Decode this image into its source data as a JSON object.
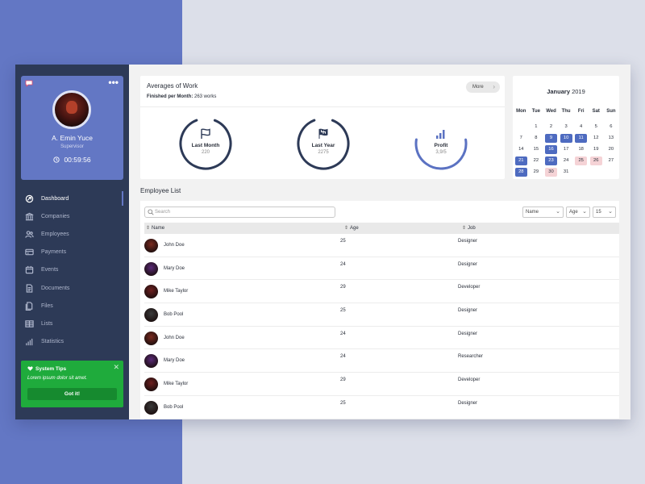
{
  "profile": {
    "name": "A. Emin Yuce",
    "role": "Supervisor",
    "timer": "00:59:56",
    "menu_label": "•••"
  },
  "nav": {
    "items": [
      {
        "label": "Dashboard",
        "icon": "dashboard-icon"
      },
      {
        "label": "Companies",
        "icon": "bank-icon"
      },
      {
        "label": "Employees",
        "icon": "users-icon"
      },
      {
        "label": "Payments",
        "icon": "card-icon"
      },
      {
        "label": "Events",
        "icon": "calendar-icon"
      },
      {
        "label": "Documents",
        "icon": "document-icon"
      },
      {
        "label": "Files",
        "icon": "files-icon"
      },
      {
        "label": "Lists",
        "icon": "table-icon"
      },
      {
        "label": "Statistics",
        "icon": "bar-chart-icon"
      }
    ],
    "active": "Dashboard"
  },
  "tips": {
    "title": "System Tips",
    "body": "Lorem ipsum dolor sit amet.",
    "button": "Got it!",
    "close": "✕"
  },
  "averages": {
    "title": "Averages of Work",
    "sub_label": "Finished per Month:",
    "sub_value": "263 works",
    "more": "More",
    "gauges": [
      {
        "label": "Last Month",
        "value": "220",
        "fraction": 0.88,
        "color": "#2d3a57",
        "icon": "flag-outline-icon"
      },
      {
        "label": "Last Year",
        "value": "2275",
        "fraction": 0.88,
        "color": "#2d3a57",
        "icon": "flag-checkered-icon"
      },
      {
        "label": "Profit",
        "value": "3,9/5",
        "fraction": 0.55,
        "color": "#5b72c2",
        "icon": "signal-bars-icon"
      }
    ]
  },
  "calendar": {
    "month": "January",
    "year": "2019",
    "weekdays": [
      "Mon",
      "Tue",
      "Wed",
      "Thu",
      "Fri",
      "Sat",
      "Sun"
    ],
    "days": [
      {
        "d": "",
        "s": ""
      },
      {
        "d": "",
        "s": ""
      },
      {
        "d": "",
        "s": ""
      },
      {
        "d": "",
        "s": ""
      },
      {
        "d": "",
        "s": ""
      },
      {
        "d": "",
        "s": ""
      },
      {
        "d": "",
        "s": ""
      }
    ],
    "grid": [
      [
        "",
        "1",
        "2",
        "3",
        "4",
        "5",
        "6"
      ],
      [
        "7",
        "8",
        "9",
        "10",
        "11",
        "12",
        "13"
      ],
      [
        "14",
        "15",
        "16",
        "17",
        "18",
        "19",
        "20"
      ],
      [
        "21",
        "22",
        "23",
        "24",
        "25",
        "26",
        "27"
      ],
      [
        "28",
        "29",
        "30",
        "31",
        "",
        "",
        ""
      ]
    ],
    "highlighted_blue": [
      "9",
      "10",
      "11",
      "16",
      "21",
      "23",
      "28"
    ],
    "highlighted_pink": [
      "25",
      "26",
      "30"
    ],
    "colors": {
      "blue": "#4e6bc0",
      "pink": "#f5d3d6"
    }
  },
  "employees": {
    "title": "Employee List",
    "search_placeholder": "Search",
    "sort_select": "Name",
    "field_select": "Age",
    "page_size": "15",
    "columns": [
      "Name",
      "Age",
      "Job"
    ],
    "rows": [
      {
        "name": "John Doe",
        "age": "25",
        "job": "Designer",
        "avatar": "#7a2a1f"
      },
      {
        "name": "Mary Doe",
        "age": "24",
        "job": "Designer",
        "avatar": "#5a2a78"
      },
      {
        "name": "Mike Taylor",
        "age": "29",
        "job": "Developer",
        "avatar": "#6e2020"
      },
      {
        "name": "Bob Pool",
        "age": "25",
        "job": "Designer",
        "avatar": "#3a3a3a"
      },
      {
        "name": "John Doe",
        "age": "24",
        "job": "Designer",
        "avatar": "#7a2a1f"
      },
      {
        "name": "Mary Doe",
        "age": "24",
        "job": "Researcher",
        "avatar": "#5a2a78"
      },
      {
        "name": "Mike Taylor",
        "age": "29",
        "job": "Developer",
        "avatar": "#6e2020"
      },
      {
        "name": "Bob Pool",
        "age": "25",
        "job": "Designer",
        "avatar": "#3a3a3a"
      }
    ]
  },
  "colors": {
    "accent": "#6377c4",
    "sidebar": "#2d3a57",
    "success": "#1fab3c"
  }
}
